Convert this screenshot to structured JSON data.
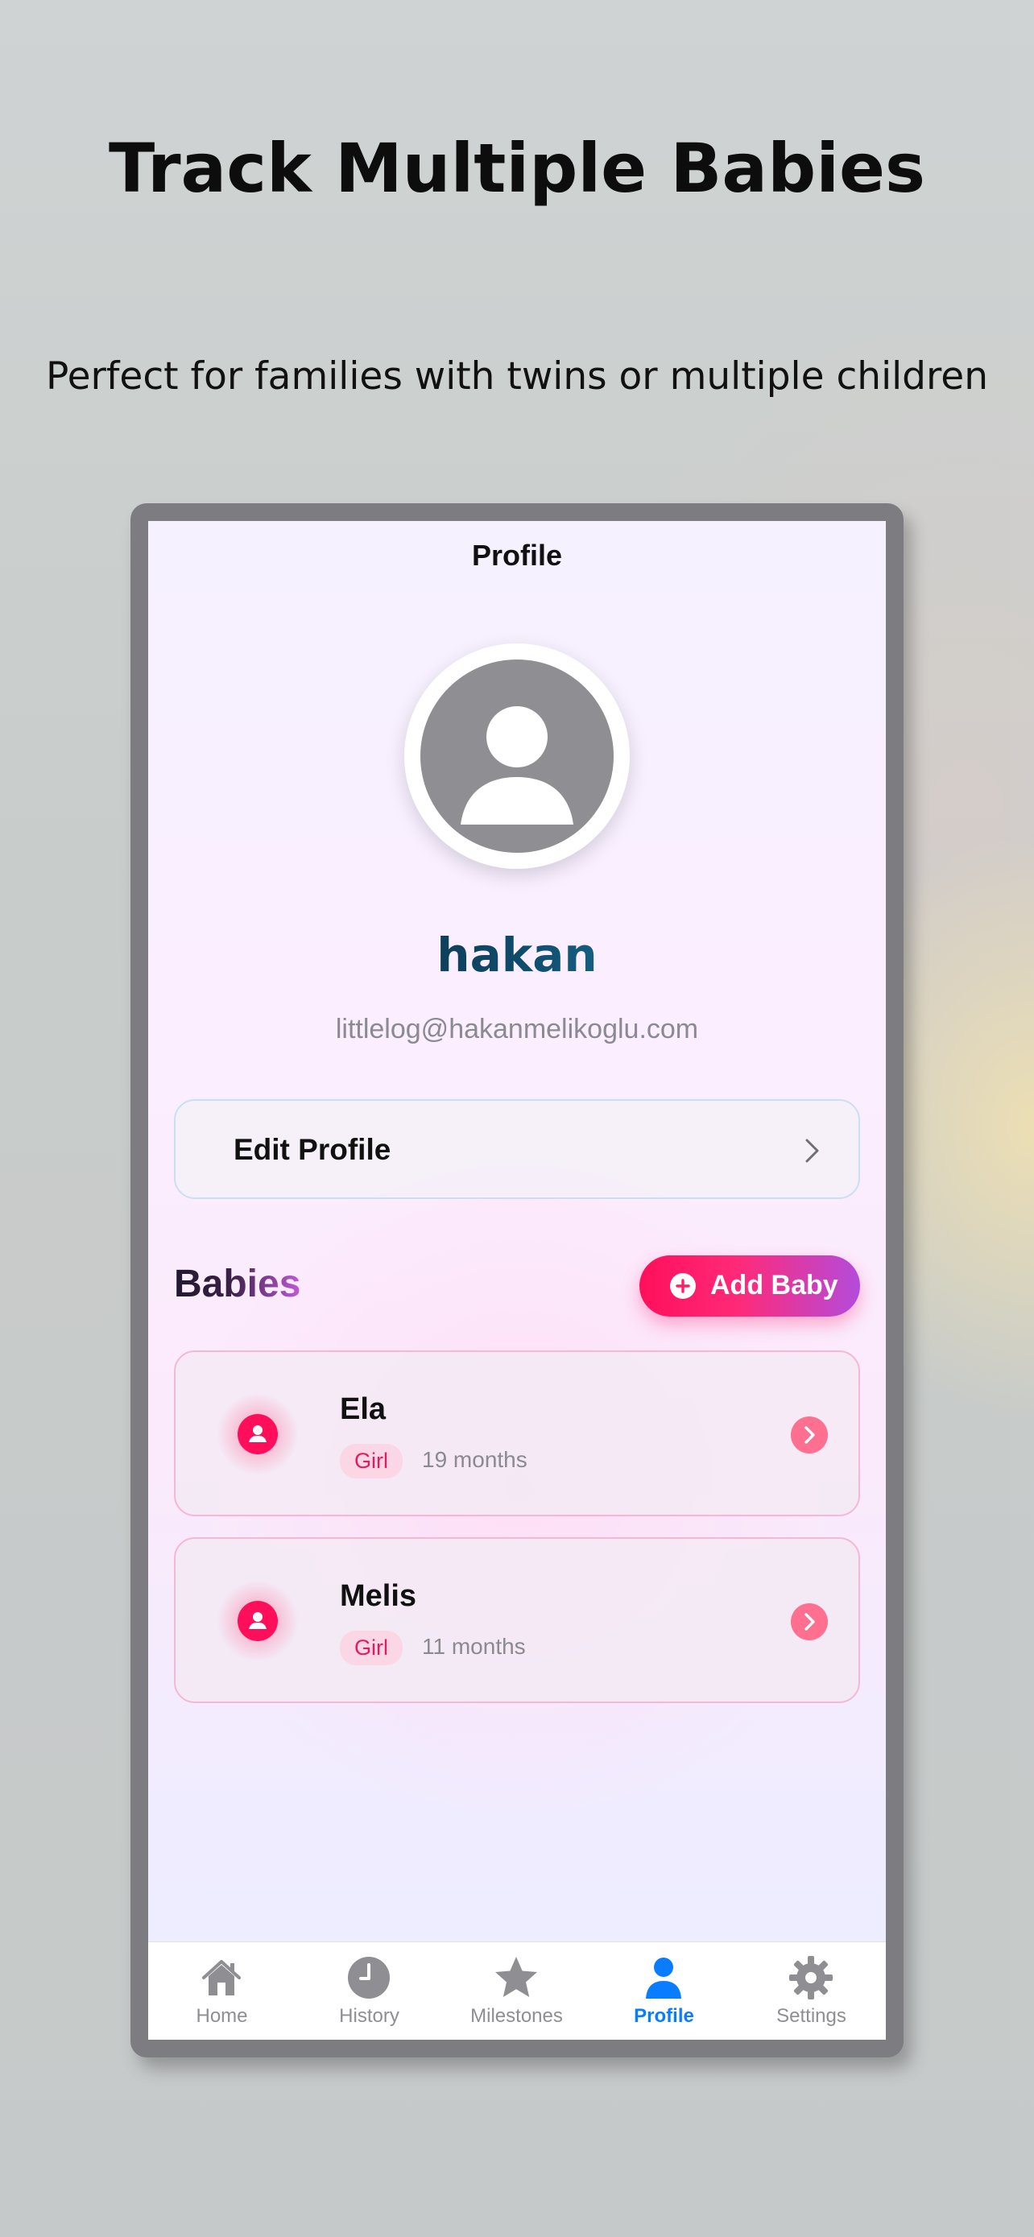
{
  "promo": {
    "headline": "Track Multiple Babies",
    "subheadline": "Perfect for families with twins or multiple children"
  },
  "screen": {
    "title": "Profile",
    "user": {
      "name": "hakan",
      "email": "littlelog@hakanmelikoglu.com"
    },
    "edit_profile_label": "Edit Profile",
    "babies_section": {
      "title": "Babies",
      "add_button_label": "Add Baby",
      "items": [
        {
          "name": "Ela",
          "gender": "Girl",
          "age": "19 months"
        },
        {
          "name": "Melis",
          "gender": "Girl",
          "age": "11 months"
        }
      ]
    },
    "tabbar": {
      "active": "Profile",
      "items": [
        {
          "label": "Home",
          "icon": "house-icon"
        },
        {
          "label": "History",
          "icon": "clock-icon"
        },
        {
          "label": "Milestones",
          "icon": "star-icon"
        },
        {
          "label": "Profile",
          "icon": "person-icon"
        },
        {
          "label": "Settings",
          "icon": "gear-icon"
        }
      ]
    }
  },
  "colors": {
    "accent": "#ff0f5b",
    "tab_active": "#0a7cff",
    "tab_inactive": "#8e8e93",
    "avatar_bg": "#8e8e93"
  }
}
